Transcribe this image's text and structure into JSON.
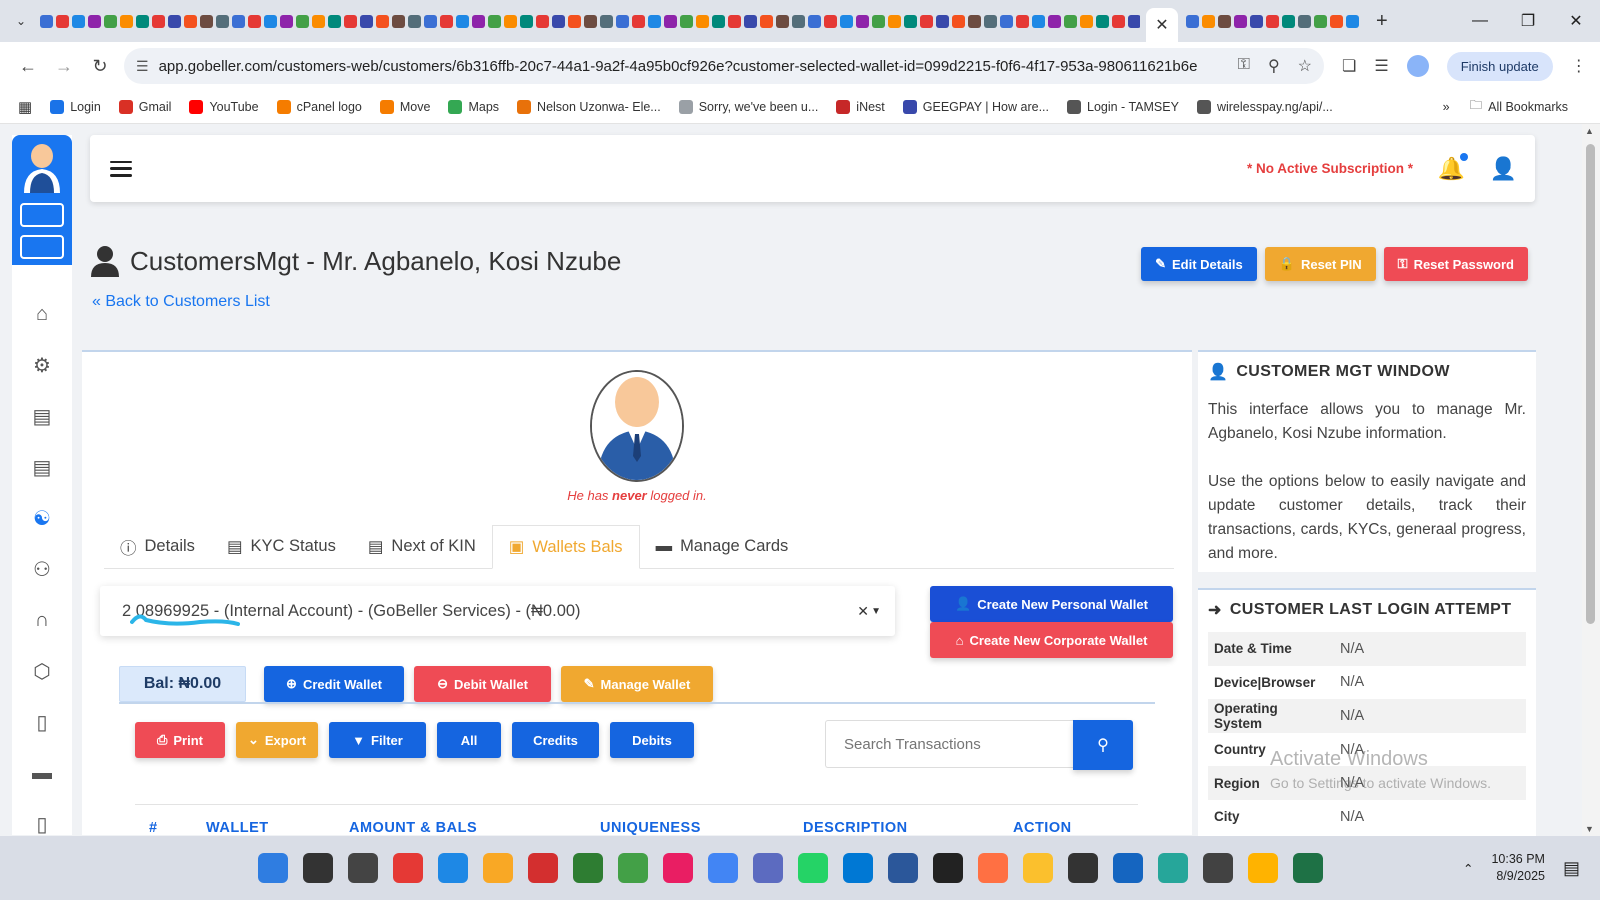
{
  "browser": {
    "url": "app.gobeller.com/customers-web/customers/6b316ffb-20c7-44a1-9a2f-4a95b0cf926e?customer-selected-wallet-id=099d2215-f0f6-4f17-953a-980611621b6e",
    "finish_update": "Finish update",
    "bookmarks": [
      "Login",
      "Gmail",
      "YouTube",
      "cPanel logo",
      "Move",
      "Maps",
      "Nelson Uzonwa- Ele...",
      "Sorry, we've been u...",
      "iNest",
      "GEEGPAY | How are...",
      "Login - TAMSEY",
      "wirelesspay.ng/api/..."
    ],
    "all_bookmarks": "All Bookmarks",
    "bookmark_colors": [
      "#1a73e8",
      "#d93025",
      "#ff0000",
      "#f57c00",
      "#f57c00",
      "#34a853",
      "#e8710a",
      "#9aa0a6",
      "#c62828",
      "#3949ab",
      "#555555",
      "#555555"
    ]
  },
  "topbar": {
    "subscription": "* No Active Subscription *"
  },
  "page": {
    "title": "CustomersMgt - Mr. Agbanelo, Kosi Nzube",
    "back_link": "Back to Customers List",
    "edit_details": "Edit Details",
    "reset_pin": "Reset PIN",
    "reset_password": "Reset Password"
  },
  "profile": {
    "login_note_pre": "He has ",
    "login_note_em": "never",
    "login_note_post": " logged in."
  },
  "tabs": {
    "details": "Details",
    "kyc": "KYC Status",
    "kin": "Next of KIN",
    "wallets": "Wallets Bals",
    "cards": "Manage Cards"
  },
  "wallet": {
    "selected": "2  08969925 - (Internal Account) - (GoBeller Services) - (₦0.00)",
    "create_personal": "Create New Personal Wallet",
    "create_corporate": "Create New Corporate Wallet",
    "balance": "Bal: ₦0.00",
    "credit": "Credit Wallet",
    "debit": "Debit Wallet",
    "manage": "Manage Wallet"
  },
  "transactions": {
    "print": "Print",
    "export": "Export",
    "filter": "Filter",
    "all": "All",
    "credits": "Credits",
    "debits": "Debits",
    "search_placeholder": "Search Transactions",
    "columns": [
      "#",
      "WALLET",
      "AMOUNT & BALS",
      "UNIQUENESS",
      "DESCRIPTION",
      "ACTION"
    ]
  },
  "side_panel": {
    "window_title": "CUSTOMER MGT WINDOW",
    "para1": "This interface allows you to manage Mr. Agbanelo, Kosi Nzube information.",
    "para2": "Use the options below to easily navigate and update customer details, track their transactions, cards, KYCs, generaal progress, and more.",
    "login_title": "CUSTOMER LAST LOGIN ATTEMPT",
    "login_rows": [
      {
        "k": "Date & Time",
        "v": "N/A"
      },
      {
        "k": "Device|Browser",
        "v": "N/A"
      },
      {
        "k": "Operating System",
        "v": "N/A"
      },
      {
        "k": "Country",
        "v": "N/A"
      },
      {
        "k": "Region",
        "v": "N/A"
      },
      {
        "k": "City",
        "v": "N/A"
      }
    ]
  },
  "watermark": {
    "line1": "Activate Windows",
    "line2": "Go to Settings to activate Windows."
  },
  "taskbar": {
    "time": "10:36 PM",
    "date": "8/9/2025"
  }
}
